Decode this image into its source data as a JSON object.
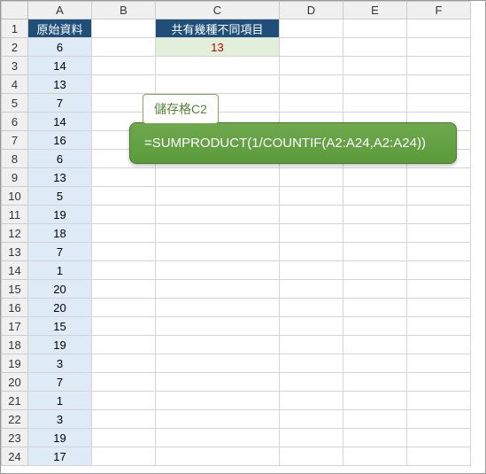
{
  "columns": [
    "A",
    "B",
    "C",
    "D",
    "E",
    "F"
  ],
  "row_count": 24,
  "a1_header": "原始資料",
  "c1_header": "共有幾種不同項目",
  "c2_result": "13",
  "a_values": [
    "6",
    "14",
    "13",
    "7",
    "14",
    "16",
    "6",
    "13",
    "5",
    "19",
    "18",
    "7",
    "1",
    "20",
    "20",
    "15",
    "19",
    "3",
    "7",
    "1",
    "3",
    "19",
    "17"
  ],
  "callout": {
    "label": "儲存格C2",
    "formula": "=SUMPRODUCT(1/COUNTIF(A2:A24,A2:A24))"
  },
  "chart_data": {
    "type": "table",
    "title": "共有幾種不同項目",
    "columns": [
      "原始資料"
    ],
    "values": [
      6,
      14,
      13,
      7,
      14,
      16,
      6,
      13,
      5,
      19,
      18,
      7,
      1,
      20,
      20,
      15,
      19,
      3,
      7,
      1,
      3,
      19,
      17
    ],
    "computed": {
      "distinct_count": 13,
      "formula": "=SUMPRODUCT(1/COUNTIF(A2:A24,A2:A24))"
    }
  }
}
